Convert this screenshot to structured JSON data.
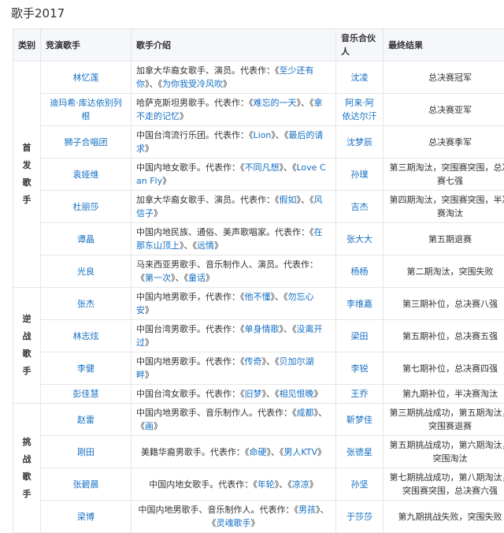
{
  "title": "歌手2017",
  "headers": [
    "类别",
    "竞演歌手",
    "歌手介绍",
    "音乐合伙人",
    "最终结果"
  ],
  "groups": [
    {
      "category": "首发歌手",
      "rows": [
        {
          "singer": "林忆莲",
          "intro": [
            {
              "t": "加拿大华裔女歌手、演员。代表作：《"
            },
            {
              "t": "至少还有你",
              "link": true
            },
            {
              "t": "》、《"
            },
            {
              "t": "为你我受冷风吹",
              "link": true
            },
            {
              "t": "》"
            }
          ],
          "partner": "沈凌",
          "result": "总决赛冠军"
        },
        {
          "singer": "迪玛希·库达依别列根",
          "intro": [
            {
              "t": "哈萨克斯坦男歌手。代表作：《"
            },
            {
              "t": "难忘的一天",
              "link": true
            },
            {
              "t": "》、《"
            },
            {
              "t": "拿不走的记忆",
              "link": true
            },
            {
              "t": "》"
            }
          ],
          "partner": "阿来·阿依达尔汗",
          "result": "总决赛亚军"
        },
        {
          "singer": "狮子合唱团",
          "intro": [
            {
              "t": "中国台湾流行乐团。代表作：《"
            },
            {
              "t": "Lion",
              "link": true
            },
            {
              "t": "》、《"
            },
            {
              "t": "最后的请求",
              "link": true
            },
            {
              "t": "》"
            }
          ],
          "partner": "沈梦辰",
          "result": "总决赛季军"
        },
        {
          "singer": "袁娅维",
          "intro": [
            {
              "t": "中国内地女歌手。代表作：《"
            },
            {
              "t": "不同凡想",
              "link": true
            },
            {
              "t": "》、《"
            },
            {
              "t": "Love Can Fly",
              "link": true
            },
            {
              "t": "》"
            }
          ],
          "partner": "孙璞",
          "result": "第三期淘汰，突围赛突围，总决赛七强"
        },
        {
          "singer": "杜丽莎",
          "intro": [
            {
              "t": "加拿大华裔女歌手、演员。代表作：《"
            },
            {
              "t": "假如",
              "link": true
            },
            {
              "t": "》、《"
            },
            {
              "t": "风信子",
              "link": true
            },
            {
              "t": "》"
            }
          ],
          "partner": "吉杰",
          "result": "第四期淘汰，突围赛突围，半决赛淘汰"
        },
        {
          "singer": "谭晶",
          "intro": [
            {
              "t": "中国内地民族、通俗、美声歌唱家。代表作：《"
            },
            {
              "t": "在那东山顶上",
              "link": true
            },
            {
              "t": "》、《"
            },
            {
              "t": "远情",
              "link": true
            },
            {
              "t": "》"
            }
          ],
          "partner": "张大大",
          "result": "第五期退赛"
        },
        {
          "singer": "光良",
          "intro": [
            {
              "t": "马来西亚男歌手、音乐制作人、演员。代表作：《"
            },
            {
              "t": "第一次",
              "link": true
            },
            {
              "t": "》、《"
            },
            {
              "t": "童话",
              "link": true
            },
            {
              "t": "》"
            }
          ],
          "partner": "杨杨",
          "result": "第二期淘汰，突围失败"
        }
      ]
    },
    {
      "category": "逆战歌手",
      "rows": [
        {
          "singer": "张杰",
          "intro": [
            {
              "t": "中国内地男歌手，代表作：《"
            },
            {
              "t": "他不懂",
              "link": true
            },
            {
              "t": "》、《"
            },
            {
              "t": "勿忘心安",
              "link": true
            },
            {
              "t": "》"
            }
          ],
          "partner": "李维嘉",
          "result": "第三期补位，总决赛八强"
        },
        {
          "singer": "林志炫",
          "intro": [
            {
              "t": "中国台湾男歌手。代表作：《"
            },
            {
              "t": "单身情歌",
              "link": true
            },
            {
              "t": "》、《"
            },
            {
              "t": "没离开过",
              "link": true
            },
            {
              "t": "》"
            }
          ],
          "partner": "梁田",
          "result": "第五期补位，总决赛五强"
        },
        {
          "singer": "李健",
          "intro": [
            {
              "t": "中国内地男歌手。代表作：《"
            },
            {
              "t": "传奇",
              "link": true
            },
            {
              "t": "》、《"
            },
            {
              "t": "贝加尔湖畔",
              "link": true
            },
            {
              "t": "》"
            }
          ],
          "partner": "李锐",
          "result": "第七期补位，总决赛四强"
        },
        {
          "singer": "彭佳慧",
          "intro": [
            {
              "t": "中国台湾女歌手。代表作：《"
            },
            {
              "t": "旧梦",
              "link": true
            },
            {
              "t": "》、《"
            },
            {
              "t": "相见恨晚",
              "link": true
            },
            {
              "t": "》"
            }
          ],
          "partner": "王乔",
          "result": "第九期补位，半决赛淘汰"
        }
      ]
    },
    {
      "category": "挑战歌手",
      "rows": [
        {
          "singer": "赵雷",
          "intro": [
            {
              "t": "中国内地男歌手、音乐制作人。代表作：《"
            },
            {
              "t": "成都",
              "link": true
            },
            {
              "t": "》、《"
            },
            {
              "t": "画",
              "link": true
            },
            {
              "t": "》"
            }
          ],
          "partner": "靳梦佳",
          "result": "第三期挑战成功，第五期淘汰，突围赛退赛"
        },
        {
          "singer": "刚田",
          "intro": [
            {
              "t": "美籍华裔男歌手。代表作：《"
            },
            {
              "t": "命硬",
              "link": true
            },
            {
              "t": "》、《"
            },
            {
              "t": "男人KTV",
              "link": true
            },
            {
              "t": "》"
            }
          ],
          "partner": "张德星",
          "result": "第五期挑战成功，第六期淘汰，突围淘汰"
        },
        {
          "singer": "张碧晨",
          "intro": [
            {
              "t": "中国内地女歌手。代表作：《"
            },
            {
              "t": "年轮",
              "link": true
            },
            {
              "t": "》、《"
            },
            {
              "t": "凉凉",
              "link": true
            },
            {
              "t": "》"
            }
          ],
          "partner": "孙坚",
          "result": "第七期挑战成功，第八期淘汰，突围赛突围，总决赛六强"
        },
        {
          "singer": "梁博",
          "intro": [
            {
              "t": "中国内地男歌手、音乐制作人。代表作：《"
            },
            {
              "t": "男孩",
              "link": true
            },
            {
              "t": "》、《"
            },
            {
              "t": "灵魂歌手",
              "link": true
            },
            {
              "t": "》"
            }
          ],
          "partner": "于莎莎",
          "result": "第九期挑战失败，突围失败"
        }
      ]
    }
  ]
}
